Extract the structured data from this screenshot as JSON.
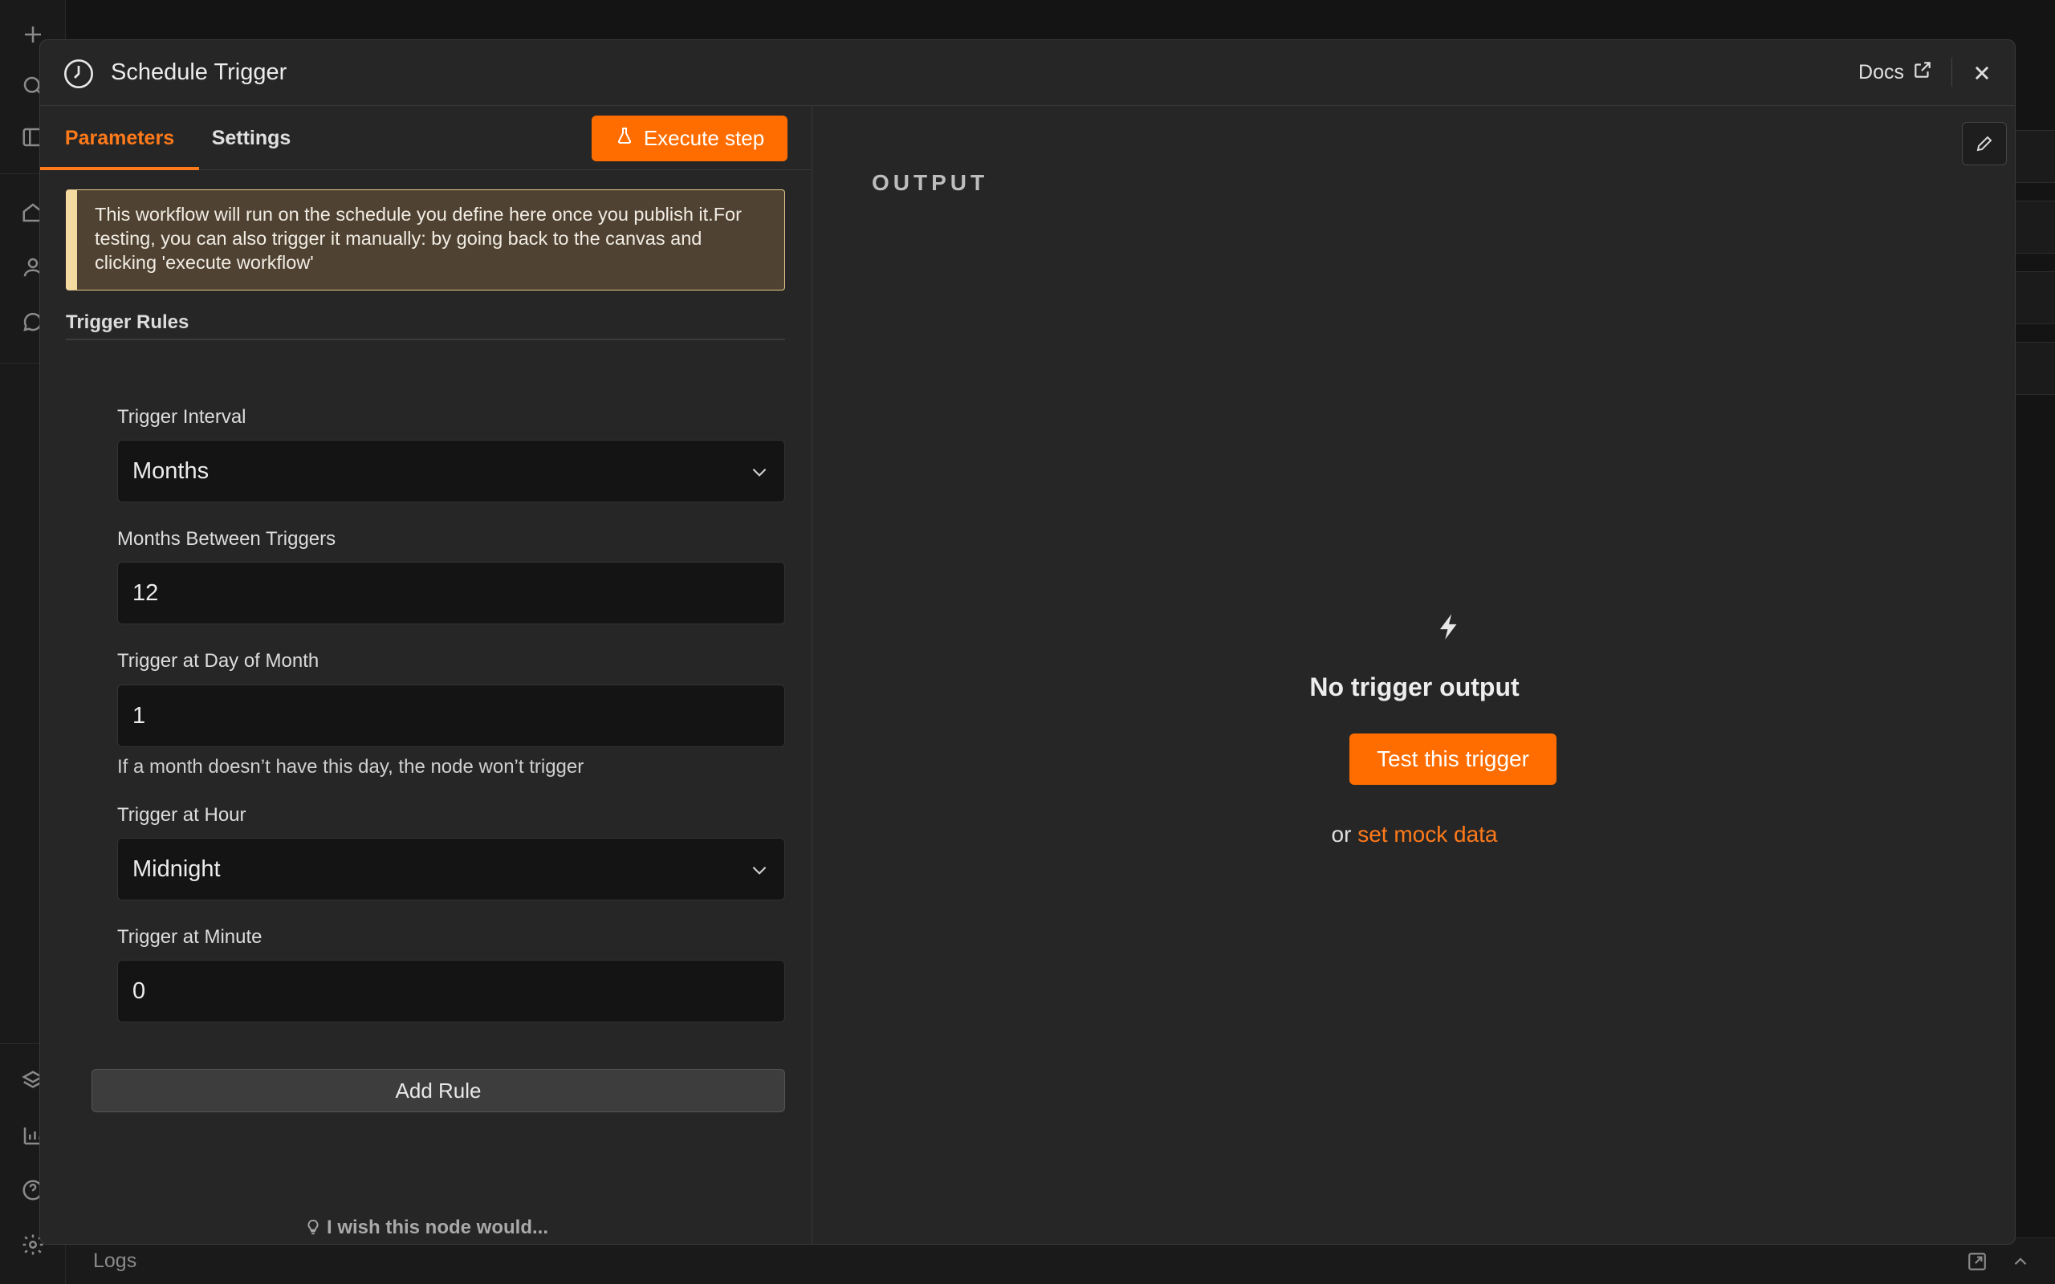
{
  "modal": {
    "title": "Schedule Trigger",
    "docs_label": "Docs"
  },
  "tabs": {
    "parameters": "Parameters",
    "settings": "Settings"
  },
  "execute_label": "Execute step",
  "notice": "This workflow will run on the schedule you define here once you publish it.For testing, you can also trigger it manually: by going back to the canvas and clicking 'execute workflow'",
  "rules": {
    "section_title": "Trigger Rules",
    "interval_label": "Trigger Interval",
    "interval_value": "Months",
    "months_between_label": "Months Between Triggers",
    "months_between_value": "12",
    "day_label": "Trigger at Day of Month",
    "day_value": "1",
    "day_hint": "If a month doesn’t have this day, the node won’t trigger",
    "hour_label": "Trigger at Hour",
    "hour_value": "Midnight",
    "minute_label": "Trigger at Minute",
    "minute_value": "0",
    "add_rule_label": "Add Rule"
  },
  "feedback_label": "I wish this node would...",
  "output": {
    "header": "OUTPUT",
    "empty_title": "No trigger output",
    "test_button": "Test this trigger",
    "or_text": "or",
    "mock_link": "set mock data"
  },
  "logs_label": "Logs",
  "colors": {
    "accent": "#ff6d00",
    "notice_bg": "#4f4232",
    "notice_border": "#e8c98a"
  }
}
